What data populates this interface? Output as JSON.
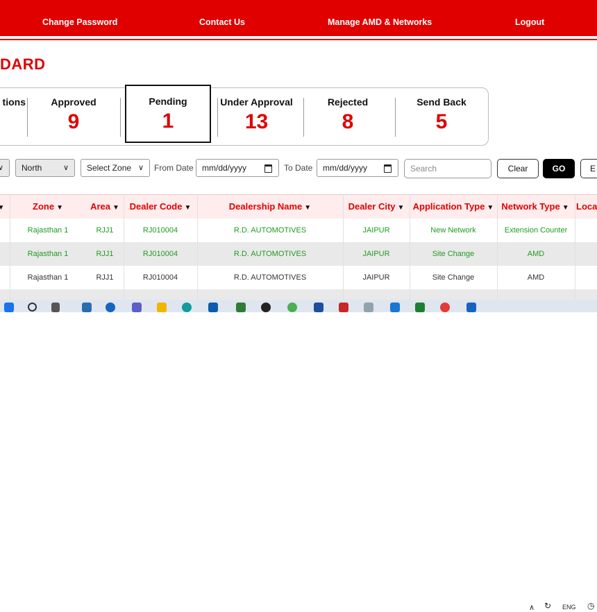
{
  "nav": {
    "items": [
      "Change Password",
      "Contact Us",
      "Manage AMD & Networks",
      "Logout"
    ]
  },
  "page_title": "DARD",
  "stats": [
    {
      "label": "tions",
      "value": ""
    },
    {
      "label": "Approved",
      "value": "9"
    },
    {
      "label": "Pending",
      "value": "1"
    },
    {
      "label": "Under Approval",
      "value": "13"
    },
    {
      "label": "Rejected",
      "value": "8"
    },
    {
      "label": "Send Back",
      "value": "5"
    }
  ],
  "filters": {
    "region_value": "North",
    "zone_value": "Select Zone",
    "from_date_label": "From Date",
    "from_date_value": "mm/dd/yyyy",
    "to_date_label": "To Date",
    "to_date_value": "mm/dd/yyyy",
    "search_placeholder": "Search",
    "clear_label": "Clear",
    "go_label": "GO",
    "export_label": "E"
  },
  "table": {
    "headers": [
      "Zone",
      "Area",
      "Dealer Code",
      "Dealership Name",
      "Dealer City",
      "Application Type",
      "Network Type",
      "Loca"
    ],
    "rows": [
      [
        "Rajasthan 1",
        "RJJ1",
        "RJ010004",
        "R.D. AUTOMOTIVES",
        "JAIPUR",
        "New Network",
        "Extension Counter"
      ],
      [
        "Rajasthan 1",
        "RJJ1",
        "RJ010004",
        "R.D. AUTOMOTIVES",
        "JAIPUR",
        "Site Change",
        "AMD"
      ],
      [
        "Rajasthan 1",
        "RJJ1",
        "RJ010004",
        "R.D. AUTOMOTIVES",
        "JAIPUR",
        "Site Change",
        "AMD"
      ]
    ]
  },
  "tray": {
    "lang": "ENG"
  },
  "colors": {
    "brand": "#e00000",
    "green_text": "#1f9b1f",
    "header_bg": "#ffecec"
  }
}
